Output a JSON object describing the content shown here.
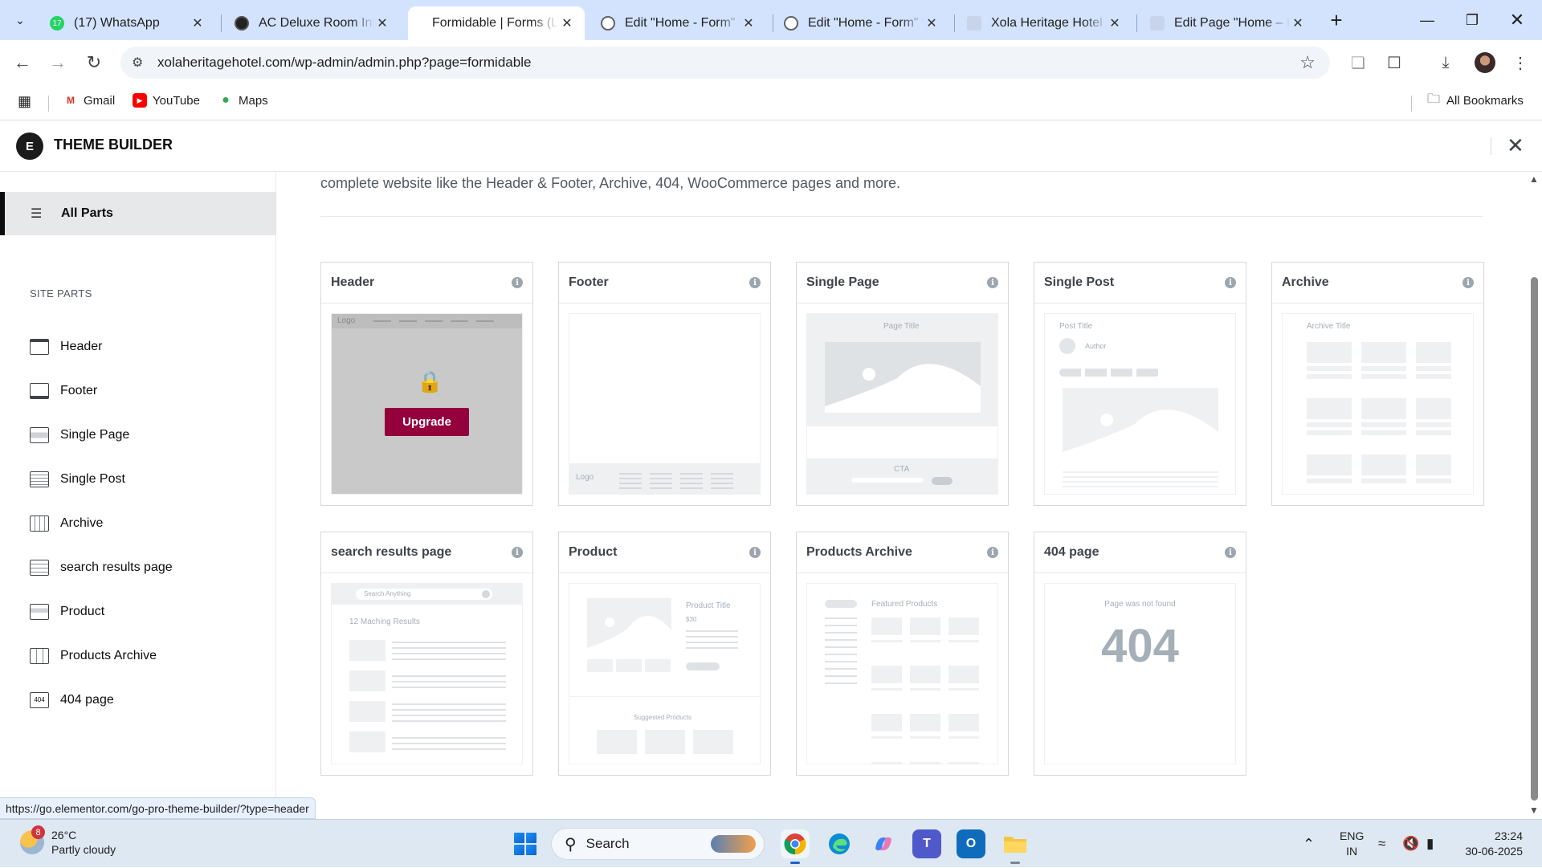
{
  "browser": {
    "tabs": [
      {
        "title": "(17) WhatsApp",
        "active": false,
        "icon": "whatsapp-icon"
      },
      {
        "title": "AC Deluxe Room Intr",
        "active": false,
        "icon": "site-icon"
      },
      {
        "title": "Formidable | Forms (L",
        "active": true,
        "icon": "none"
      },
      {
        "title": "Edit \"Home - Form\" v",
        "active": false,
        "icon": "globe-icon"
      },
      {
        "title": "Edit \"Home - Form\" v",
        "active": false,
        "icon": "globe-icon"
      },
      {
        "title": "Xola Heritage Hotel",
        "active": false,
        "icon": "page-icon"
      },
      {
        "title": "Edit Page \"Home – Fo",
        "active": false,
        "icon": "page-icon"
      }
    ],
    "url": "xolaheritagehotel.com/wp-admin/admin.php?page=formidable",
    "bookmarks": [
      {
        "label": "Gmail"
      },
      {
        "label": "YouTube"
      },
      {
        "label": "Maps"
      }
    ],
    "all_bookmarks": "All Bookmarks"
  },
  "theme_builder": {
    "logo_letter": "E",
    "title": "THEME BUILDER"
  },
  "sidebar": {
    "all_parts": "All Parts",
    "section_label": "SITE PARTS",
    "items": [
      {
        "label": "Header"
      },
      {
        "label": "Footer"
      },
      {
        "label": "Single Page"
      },
      {
        "label": "Single Post"
      },
      {
        "label": "Archive"
      },
      {
        "label": "search results page"
      },
      {
        "label": "Product"
      },
      {
        "label": "Products Archive"
      },
      {
        "label": "404 page"
      }
    ]
  },
  "main": {
    "intro": "complete website like the Header & Footer, Archive, 404, WooCommerce pages and more.",
    "cards": [
      {
        "title": "Header"
      },
      {
        "title": "Footer"
      },
      {
        "title": "Single Page"
      },
      {
        "title": "Single Post"
      },
      {
        "title": "Archive"
      },
      {
        "title": "search results page"
      },
      {
        "title": "Product"
      },
      {
        "title": "Products Archive"
      },
      {
        "title": "404 page"
      }
    ],
    "upgrade_label": "Upgrade",
    "wire": {
      "logo": "Logo",
      "page_title": "Page Title",
      "cta": "CTA",
      "post_title": "Post Title",
      "author": "Author",
      "archive_title": "Archive Title",
      "search_placeholder": "Search Anything",
      "matching": "12 Maching Results",
      "product_title": "Product Title",
      "price": "$30",
      "suggested": "Suggested Products",
      "featured": "Featured Products",
      "not_found": "Page was not found",
      "code_404": "404"
    }
  },
  "status_url": "https://go.elementor.com/go-pro-theme-builder/?type=header",
  "taskbar": {
    "weather_badge": "8",
    "temperature": "26°C",
    "weather": "Partly cloudy",
    "search_label": "Search",
    "lang1": "ENG",
    "lang2": "IN",
    "time": "23:24",
    "date": "30-06-2025"
  },
  "colors": {
    "accent_upgrade": "#93003c",
    "tabstrip": "#d3e3fd",
    "sidebar_active": "#e6e8ea"
  }
}
